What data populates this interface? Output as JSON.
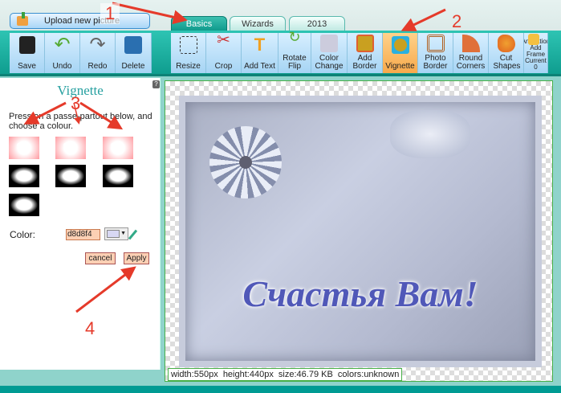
{
  "header": {
    "upload_label": "Upload new picture",
    "tabs": [
      {
        "label": "Basics",
        "active": true
      },
      {
        "label": "Wizards"
      },
      {
        "label": "2013"
      }
    ]
  },
  "toolbar": {
    "left": [
      {
        "label": "Save",
        "icon": "floppy-icon"
      },
      {
        "label": "Undo",
        "icon": "undo-icon"
      },
      {
        "label": "Redo",
        "icon": "redo-icon"
      },
      {
        "label": "Delete",
        "icon": "delete-icon"
      }
    ],
    "tools": [
      {
        "label": "Resize",
        "icon": "resize-icon"
      },
      {
        "label": "Crop",
        "icon": "scissors-icon"
      },
      {
        "label": "Add Text",
        "icon": "text-icon"
      },
      {
        "label": "Rotate Flip",
        "icon": "rotate-icon"
      },
      {
        "label": "Color Change",
        "icon": "color-change-icon"
      },
      {
        "label": "Add Border",
        "icon": "border-icon"
      },
      {
        "label": "Vignette",
        "icon": "vignette-icon",
        "selected": true
      },
      {
        "label": "Photo Border",
        "icon": "photo-border-icon"
      },
      {
        "label": "Round Corners",
        "icon": "round-corners-icon"
      },
      {
        "label": "Cut Shapes",
        "icon": "cut-shapes-icon"
      },
      {
        "label": "Animation",
        "sub": "Add Frame Current 0",
        "icon": "animation-icon"
      }
    ]
  },
  "panel": {
    "title": "Vignette",
    "help": "?",
    "instructions": "Press on a passe-partout below, and choose a colour.",
    "color_label": "Color:",
    "color_value": "d8d8f4",
    "cancel_label": "cancel",
    "apply_label": "Apply"
  },
  "canvas": {
    "image_text": "Счастья Вам!",
    "info": "width:550px  height:440px  size:46.79 KB  colors:unknown"
  },
  "annotations": [
    "1",
    "2",
    "3",
    "4"
  ],
  "colors": {
    "accent": "#12a898",
    "selected": "#f7a94b",
    "arrow": "#e53a2a"
  }
}
